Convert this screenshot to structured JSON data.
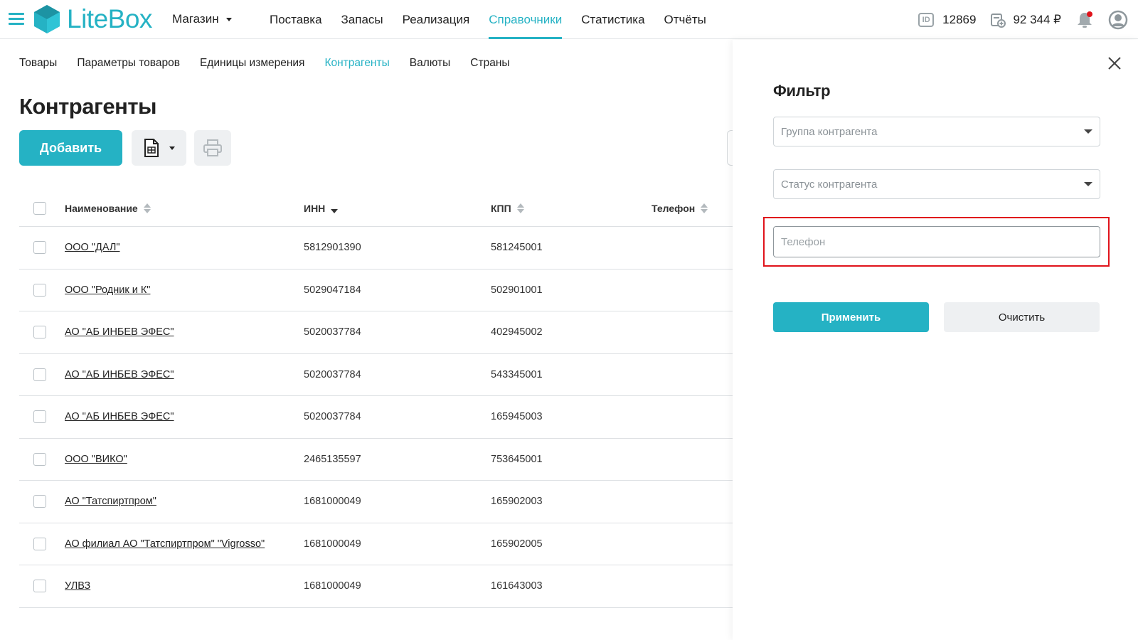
{
  "header": {
    "logo_text": "LiteBox",
    "store_label": "Магазин",
    "nav": [
      "Поставка",
      "Запасы",
      "Реализация",
      "Справочники",
      "Статистика",
      "Отчёты"
    ],
    "active_nav": "Справочники",
    "account_id_badge": "ID",
    "account_id": "12869",
    "balance": "92 344 ₽",
    "accent_color": "#25b2c4",
    "notification_dot_color": "#e0131b"
  },
  "subnav": {
    "items": [
      "Товары",
      "Параметры товаров",
      "Единицы измерения",
      "Контрагенты",
      "Валюты",
      "Страны"
    ],
    "active": "Контрагенты"
  },
  "page": {
    "title": "Контрагенты",
    "add_button": "Добавить"
  },
  "table": {
    "columns": [
      "Наименование",
      "ИНН",
      "КПП",
      "Телефон"
    ],
    "rows": [
      {
        "name": "ООО \"ДАЛ\"",
        "inn": "5812901390",
        "kpp": "581245001",
        "phone": ""
      },
      {
        "name": "ООО \"Родник и К\"",
        "inn": "5029047184",
        "kpp": "502901001",
        "phone": ""
      },
      {
        "name": "АО \"АБ ИНБЕВ ЭФЕС\"",
        "inn": "5020037784",
        "kpp": "402945002",
        "phone": ""
      },
      {
        "name": "АО \"АБ ИНБЕВ ЭФЕС\"",
        "inn": "5020037784",
        "kpp": "543345001",
        "phone": ""
      },
      {
        "name": "АО \"АБ ИНБЕВ ЭФЕС\"",
        "inn": "5020037784",
        "kpp": "165945003",
        "phone": ""
      },
      {
        "name": "ООО \"ВИКО\"",
        "inn": "2465135597",
        "kpp": "753645001",
        "phone": ""
      },
      {
        "name": "АО \"Татспиртпром\"",
        "inn": "1681000049",
        "kpp": "165902003",
        "phone": ""
      },
      {
        "name": "АО филиал АО \"Татспиртпром\" \"Vigrosso\"",
        "inn": "1681000049",
        "kpp": "165902005",
        "phone": ""
      },
      {
        "name": "УЛВЗ",
        "inn": "1681000049",
        "kpp": "161643003",
        "phone": ""
      }
    ]
  },
  "filter": {
    "title": "Фильтр",
    "group_placeholder": "Группа контрагента",
    "status_placeholder": "Статус контрагента",
    "phone_placeholder": "Телефон",
    "phone_value": "",
    "apply_label": "Применить",
    "clear_label": "Очистить",
    "highlight_color": "#e0131b"
  }
}
